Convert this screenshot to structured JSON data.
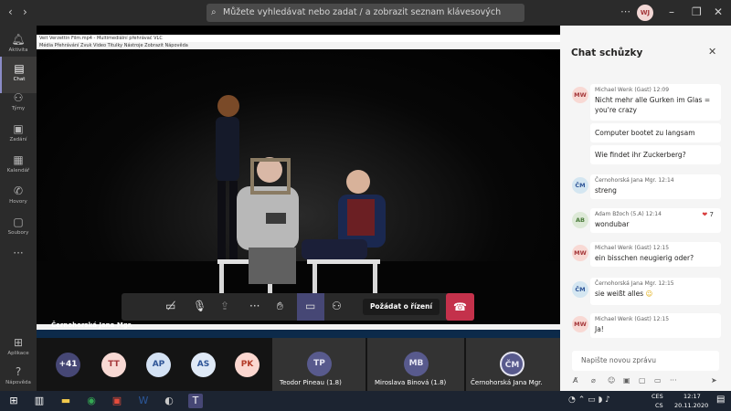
{
  "topbar": {
    "search_placeholder": "Můžete vyhledávat nebo zadat / a zobrazit seznam klávesových zkratek.",
    "user_initials": "WJ"
  },
  "rail": {
    "items": [
      {
        "label": "Aktivita",
        "icon": "bell-icon"
      },
      {
        "label": "Chat",
        "icon": "chat-icon"
      },
      {
        "label": "Týmy",
        "icon": "teams-icon"
      },
      {
        "label": "Zadání",
        "icon": "assignments-icon"
      },
      {
        "label": "Kalendář",
        "icon": "calendar-icon"
      },
      {
        "label": "Hovory",
        "icon": "phone-icon"
      },
      {
        "label": "Soubory",
        "icon": "files-icon"
      },
      {
        "label": "Aplikace",
        "icon": "apps-icon"
      },
      {
        "label": "Nápověda",
        "icon": "help-icon"
      }
    ]
  },
  "vlc": {
    "title": "Veit Verzettin Film.mp4 - Multimediální přehrávač VLC",
    "menu": "Média   Přehrávání   Zvuk   Video   Titulky   Nástroje   Zobrazit   Nápověda"
  },
  "meeting": {
    "control_button": "Požádat o řízení",
    "presenter": "Černohorská Jana Mgr."
  },
  "participants": {
    "more_count": "+41",
    "avatars": [
      {
        "initials": "TT",
        "bg": "#f8d9d4",
        "fg": "#a4373a"
      },
      {
        "initials": "AP",
        "bg": "#d4e2f4",
        "fg": "#2f5597"
      },
      {
        "initials": "AS",
        "bg": "#dfe9f6",
        "fg": "#2f5597"
      },
      {
        "initials": "PK",
        "bg": "#fbd7d0",
        "fg": "#b33b28"
      }
    ],
    "tiles": [
      {
        "initials": "TP",
        "name": "Teodor Pineau (1.8)"
      },
      {
        "initials": "MB",
        "name": "Miroslava Binová (1.8)"
      },
      {
        "initials": "ČM",
        "name": "Černohorská Jana Mgr."
      }
    ]
  },
  "chat": {
    "title": "Chat schůzky",
    "messages": [
      {
        "initials": "MW",
        "author": "Michael Wenk (Gast)",
        "time": "12:09",
        "text": "Nicht mehr alle Gurken im Glas = you're crazy"
      },
      {
        "text": "Computer bootet zu langsam"
      },
      {
        "text": "Wie findet ihr Zuckerberg?"
      },
      {
        "initials": "ČM",
        "author": "Černohorská Jana Mgr.",
        "time": "12:14",
        "text": "streng"
      },
      {
        "initials": "AB",
        "author": "Adam Bžoch (5.A)",
        "time": "12:14",
        "text": "wondubar",
        "reaction": "7"
      },
      {
        "initials": "MW",
        "author": "Michael Wenk (Gast)",
        "time": "12:15",
        "text": "ein bisschen neugierig oder?"
      },
      {
        "initials": "ČM",
        "author": "Černohorská Jana Mgr.",
        "time": "12:15",
        "text": "sie weißt alles"
      },
      {
        "initials": "MW",
        "author": "Michael Wenk (Gast)",
        "time": "12:15",
        "text": "Ja!"
      }
    ],
    "compose_placeholder": "Napište novou zprávu"
  },
  "taskbar": {
    "lang1": "CES",
    "lang2": "CS",
    "time": "12:17",
    "date": "20.11.2020"
  }
}
